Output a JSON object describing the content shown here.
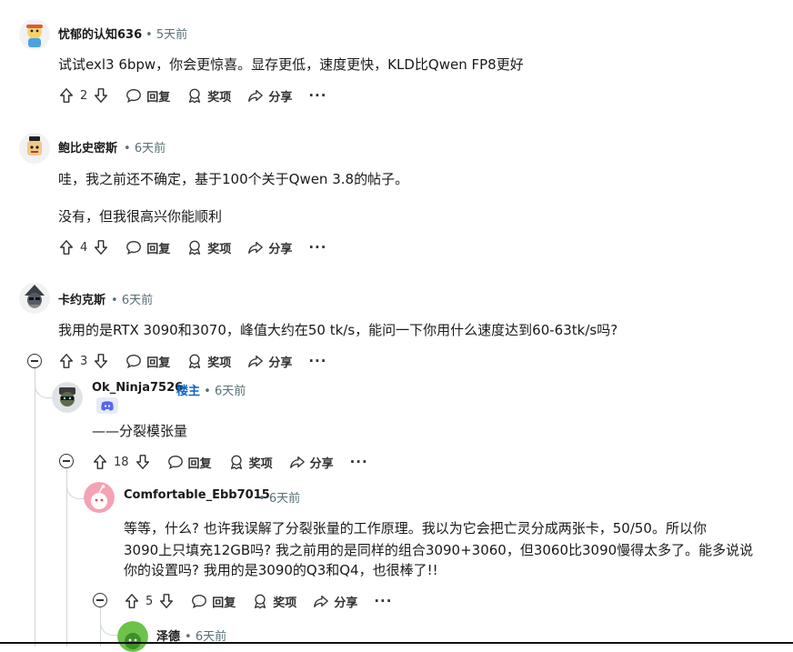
{
  "comments": [
    {
      "username": "忧郁的认知636",
      "time": "5天前",
      "lines": [
        "试试exl3 6bpw，你会更惊喜。显存更低，速度更快，KLD比Qwen FP8更好"
      ],
      "votes": "2"
    },
    {
      "username": "鲍比史密斯",
      "time": "6天前",
      "lines": [
        "哇，我之前还不确定，基于100个关于Qwen 3.8的帖子。",
        "没有，但我很高兴你能顺利"
      ],
      "votes": "4"
    },
    {
      "username": "卡约克斯",
      "time": "6天前",
      "lines": [
        "我用的是RTX 3090和3070，峰值大约在50 tk/s，能问一下你用什么速度达到60-63tk/s吗?"
      ],
      "votes": "3"
    },
    {
      "username": "Ok_Ninja7526",
      "op_badge": "楼主",
      "time": "6天前",
      "lines": [
        "——分裂模张量"
      ],
      "votes": "18"
    },
    {
      "username": "Comfortable_Ebb7015",
      "time": "6天前",
      "lines": [
        "等等，什么? 也许我误解了分裂张量的工作原理。我以为它会把亡灵分成两张卡，50/50。所以你",
        "3090上只填充12GB吗? 我之前用的是同样的组合3090+3060，但3060比3090慢得太多了。能多说说",
        "你的设置吗? 我用的是3090的Q3和Q4，也很棒了!!"
      ],
      "votes": "5"
    },
    {
      "username": "泽德",
      "time": "6天前"
    }
  ],
  "actions": {
    "reply": "回复",
    "award": "奖项",
    "share": "分享",
    "more": "···"
  },
  "separator": "•",
  "icons": [
    "upvote-icon",
    "downvote-icon",
    "reply-bubble-icon",
    "award-icon",
    "share-arrow-icon",
    "collapse-icon",
    "discord-icon"
  ]
}
